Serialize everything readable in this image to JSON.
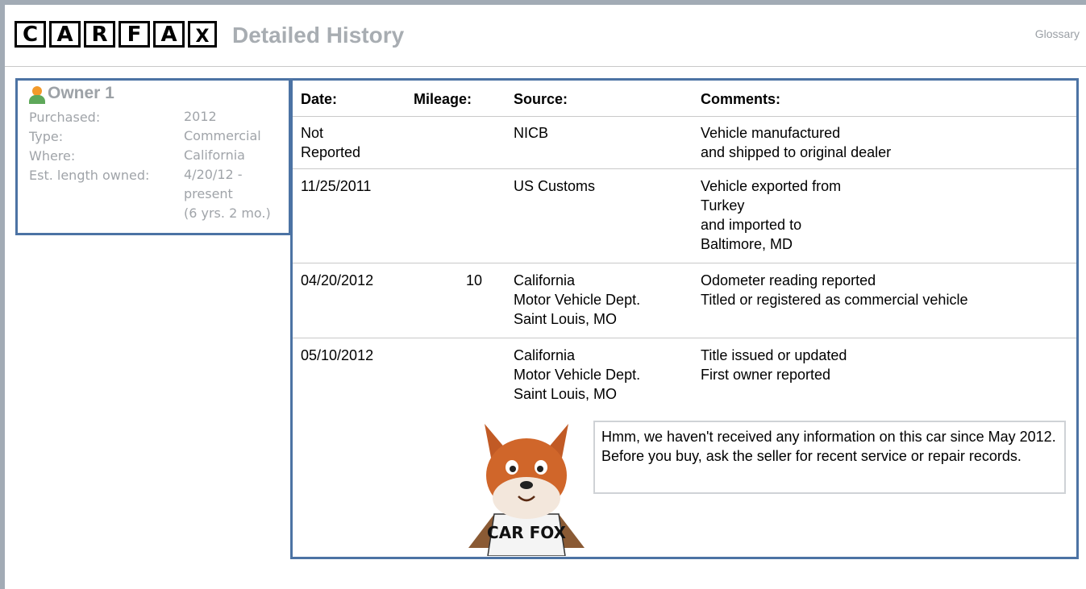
{
  "header": {
    "logo_letters": [
      "C",
      "A",
      "R",
      "F",
      "A",
      "X"
    ],
    "title": "Detailed History",
    "glossary_label": "Glossary"
  },
  "owner": {
    "title": "Owner 1",
    "fields": [
      {
        "label": "Purchased:",
        "value": "2012"
      },
      {
        "label": "Type:",
        "value": "Commercial"
      },
      {
        "label": "Where:",
        "value": "California"
      },
      {
        "label": "Est. length owned:",
        "value_lines": [
          "4/20/12 -",
          "present",
          "(6 yrs. 2 mo.)"
        ]
      }
    ]
  },
  "history": {
    "headers": {
      "date": "Date:",
      "mileage": "Mileage:",
      "source": "Source:",
      "comments": "Comments:"
    },
    "rows": [
      {
        "date": [
          "Not",
          "Reported"
        ],
        "mileage": "",
        "source": [
          "NICB"
        ],
        "comments": [
          "Vehicle manufactured",
          "and shipped to original dealer"
        ]
      },
      {
        "date": [
          "11/25/2011"
        ],
        "mileage": "",
        "source": [
          "US Customs"
        ],
        "comments": [
          "Vehicle exported from",
          "Turkey",
          "and imported to",
          "Baltimore, MD"
        ]
      },
      {
        "date": [
          "04/20/2012"
        ],
        "mileage": "10",
        "source": [
          "California",
          "Motor Vehicle Dept.",
          "Saint Louis, MO"
        ],
        "comments": [
          "Odometer reading reported",
          "Titled or registered as commercial vehicle"
        ]
      },
      {
        "date": [
          "05/10/2012"
        ],
        "mileage": "",
        "source": [
          "California",
          "Motor Vehicle Dept.",
          "Saint Louis, MO"
        ],
        "comments": [
          "Title issued or updated",
          "First owner reported"
        ]
      }
    ],
    "fox_shirt": "CAR FOX",
    "notice": "Hmm, we haven't received any information on this car since May 2012. Before you buy, ask the seller for recent service or repair records."
  },
  "colors": {
    "panel_border": "#4c73a4",
    "title_gray": "#a8adb2",
    "rule": "#a2abb5"
  }
}
